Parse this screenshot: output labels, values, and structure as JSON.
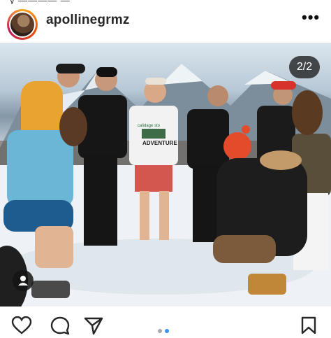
{
  "post": {
    "username": "apollinegrmz",
    "image_counter": "2/2",
    "carousel_total": 2,
    "carousel_active_index": 1
  },
  "icons": {
    "more": "more-options-icon",
    "tag": "user-tag-icon",
    "like": "heart-icon",
    "comment": "comment-icon",
    "share": "share-icon",
    "save": "bookmark-icon"
  },
  "photo": {
    "tshirt_text_top": "calidage sto",
    "tshirt_text_main": "ADVENTURE"
  },
  "colors": {
    "carousel_active": "#3897f0",
    "carousel_inactive": "#a8a8a8"
  }
}
